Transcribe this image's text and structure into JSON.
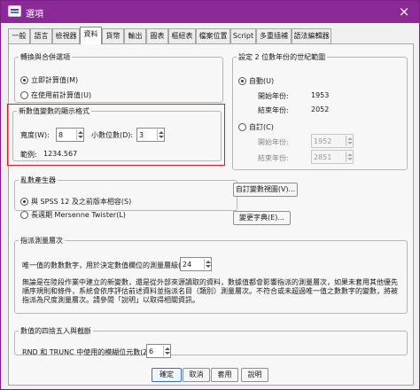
{
  "window": {
    "title": "選項",
    "icon": "app-window-icon"
  },
  "tabs": [
    "一般",
    "語言",
    "檢視器",
    "資料",
    "貨幣",
    "輸出",
    "圖表",
    "樞紐表",
    "檔案位置",
    "Script",
    "多重插補",
    "語法編輯器"
  ],
  "active_tab": "資料",
  "transformation": {
    "legend": "轉換與合併選項",
    "options": [
      "立即計算值(M)",
      "在使用前計算值(U)"
    ],
    "selected": 0
  },
  "numeric_display": {
    "legend": "新數值變數的顯示格式",
    "width_label": "寬度(W):",
    "width_value": "8",
    "decimals_label": "小數位數(D):",
    "decimals_value": "3",
    "example_label": "範例:",
    "example_value": "1234.567"
  },
  "century": {
    "legend": "設定 2 位數年份的世紀範圍",
    "automatic_label": "自動(U)",
    "custom_label": "自訂(C)",
    "start_label": "開始年份:",
    "end_label": "結束年份:",
    "auto_start": "1953",
    "auto_end": "2052",
    "custom_start": "1952",
    "custom_end": "2851"
  },
  "rng": {
    "legend": "亂數產生器",
    "options": [
      "與 SPSS 12 及之前版本相容(S)",
      "長週期 Mersenne Twister(L)"
    ],
    "selected": 0
  },
  "side_buttons": {
    "custom_variable_view": "自訂變數視圖(V)...",
    "change_dictionary": "變更字典(E)..."
  },
  "measurement": {
    "legend": "指派測量層次",
    "label": "唯一值的數數數字，用於決定數值欄位的測量層級(N)",
    "value": "24",
    "description": "無論是在陸段作業中建立的新變數，還是從外部來源讀取的資料，數據值都會影響指派的測量層次，如果未套用其他優先順序規則和條件，系統會依序評估前述資料並指派名目（類別）測量層次。不符合或未超過唯一值之數數字的變數，將被指派為尺度測量層次。請參閱「說明」以取得相關資訊。"
  },
  "rounding": {
    "legend": "數值的四捨五入與截斷",
    "label": "RND 和 TRUNC 中使用的模糊位元數(Z):",
    "value": "6"
  },
  "footer": {
    "ok": "確定",
    "cancel": "取消",
    "apply": "套用",
    "help": "說明"
  }
}
